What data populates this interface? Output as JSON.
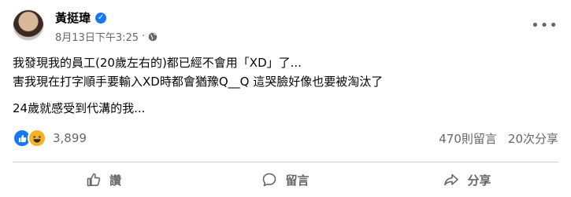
{
  "post": {
    "author_name": "黃挺瑋",
    "timestamp": "8月13日下午3:25",
    "separator": "·",
    "more_icon": "more-horizontal-icon",
    "body": {
      "line1": "我發現我的員工(20歲左右的)都已經不會用「XD」了...",
      "line2": "害我現在打字順手要輸入XD時都會猶豫Q__Q 這哭臉好像也要被淘汰了",
      "line3": "24歲就感受到代溝的我..."
    },
    "reaction_count": "3,899",
    "comment_count": "470則留言",
    "share_count": "20次分享"
  },
  "actions": {
    "like_label": "讚",
    "comment_label": "留言",
    "share_label": "分享"
  },
  "colors": {
    "accent": "#1877f2",
    "secondary_text": "#65676b",
    "haha": "#f7b125"
  }
}
